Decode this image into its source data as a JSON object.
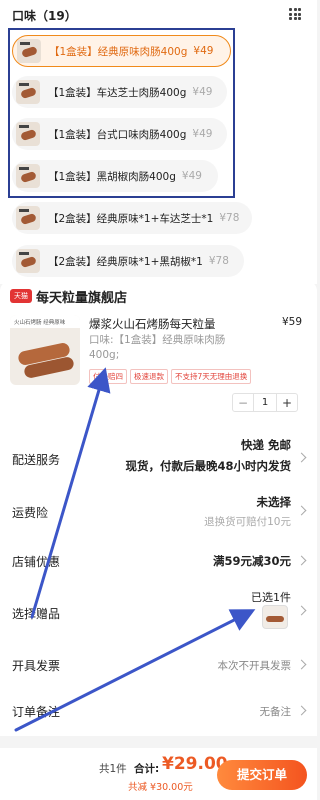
{
  "flavor_section": {
    "title": "口味（19）",
    "grid_icon": "grid-icon",
    "options": [
      {
        "label": "【1盒装】经典原味肉肠400g",
        "price": "¥49",
        "selected": true
      },
      {
        "label": "【1盒装】车达芝士肉肠400g",
        "price": "¥49",
        "selected": false
      },
      {
        "label": "【1盒装】台式口味肉肠400g",
        "price": "¥49",
        "selected": false
      },
      {
        "label": "【1盒装】黑胡椒肉肠400g",
        "price": "¥49",
        "selected": false
      },
      {
        "label": "【2盒装】经典原味*1+车达芝士*1",
        "price": "¥78",
        "selected": false
      },
      {
        "label": "【2盒装】经典原味*1+黑胡椒*1",
        "price": "¥78",
        "selected": false
      }
    ]
  },
  "shop": {
    "badge": "天猫",
    "name": "每天粒量旗舰店"
  },
  "product": {
    "image_caption": "火山石烤肠 经典原味",
    "title": "爆浆火山石烤肠每天粒量",
    "price": "¥59",
    "spec": "口味:【1盒装】经典原味肉肠400g;",
    "tags": [
      "付一赔四",
      "极速退款",
      "不支持7天无理由退换"
    ],
    "quantity": "1",
    "minus": "−",
    "plus": "+"
  },
  "rows": {
    "delivery": {
      "label": "配送服务",
      "line1": "快递 免邮",
      "line2": "现货，付款后最晚48小时内发货"
    },
    "insurance": {
      "label": "运费险",
      "line1": "未选择",
      "line2": "退换货可赔付10元"
    },
    "discount": {
      "label": "店铺优惠",
      "value": "满59元减30元"
    },
    "gift": {
      "label": "选择赠品",
      "value": "已选1件"
    },
    "invoice": {
      "label": "开具发票",
      "value": "本次不开具发票"
    },
    "note": {
      "label": "订单备注",
      "value": "无备注"
    }
  },
  "bottom": {
    "count": "共1件",
    "total_label": "合计:",
    "total": "¥29.00",
    "discount": "共减 ¥30.00元",
    "submit": "提交订单"
  },
  "colors": {
    "accent": "#f08a1b",
    "price_red": "#ec5a24",
    "annotation_blue": "#2b3f93"
  }
}
